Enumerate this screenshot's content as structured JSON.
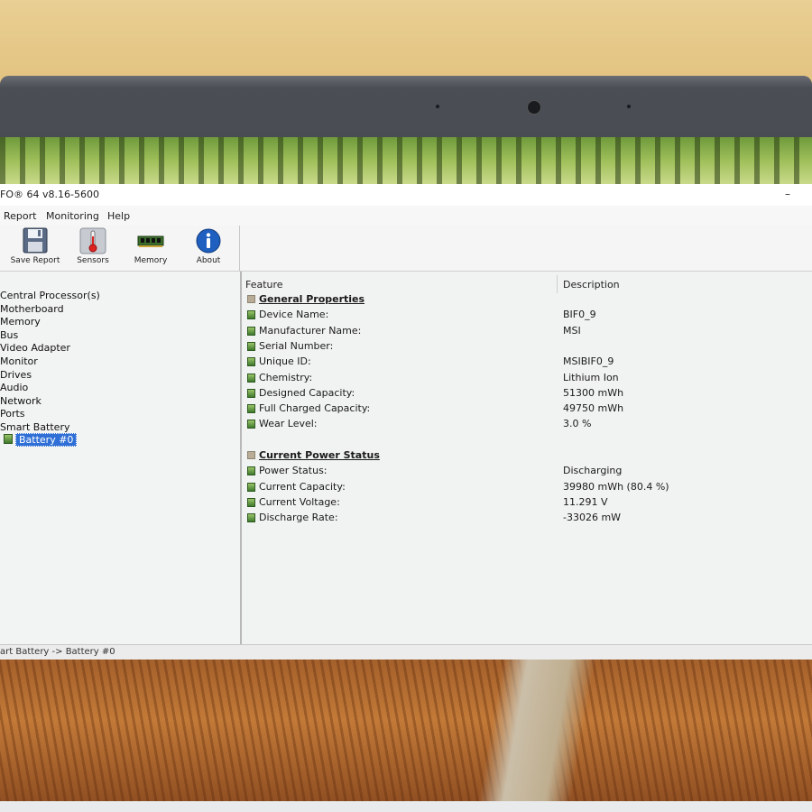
{
  "window": {
    "title": "FO® 64 v8.16-5600",
    "minimize_glyph": "–"
  },
  "menu": [
    "Report",
    "Monitoring",
    "Help"
  ],
  "toolbar": [
    {
      "label": "Save Report",
      "icon": "floppy-disk-icon"
    },
    {
      "label": "Sensors",
      "icon": "thermometer-icon"
    },
    {
      "label": "Memory",
      "icon": "memory-module-icon"
    },
    {
      "label": "About",
      "icon": "info-icon"
    }
  ],
  "tree": {
    "items": [
      "Central Processor(s)",
      "Motherboard",
      "Memory",
      "Bus",
      "Video Adapter",
      "Monitor",
      "Drives",
      "Audio",
      "Network",
      "Ports",
      "Smart Battery"
    ],
    "selected": "Battery #0"
  },
  "table": {
    "headers": {
      "feature": "Feature",
      "description": "Description"
    },
    "sections": [
      {
        "title": "General Properties",
        "rows": [
          {
            "feature": "Device Name:",
            "value": "BIF0_9"
          },
          {
            "feature": "Manufacturer Name:",
            "value": "MSI"
          },
          {
            "feature": "Serial Number:",
            "value": ""
          },
          {
            "feature": "Unique ID:",
            "value": "MSIBIF0_9"
          },
          {
            "feature": "Chemistry:",
            "value": "Lithium Ion"
          },
          {
            "feature": "Designed Capacity:",
            "value": "51300 mWh"
          },
          {
            "feature": "Full Charged Capacity:",
            "value": "49750 mWh"
          },
          {
            "feature": "Wear Level:",
            "value": "3.0 %"
          }
        ]
      },
      {
        "title": "Current Power Status",
        "rows": [
          {
            "feature": "Power Status:",
            "value": "Discharging"
          },
          {
            "feature": "Current Capacity:",
            "value": "39980 mWh (80.4 %)"
          },
          {
            "feature": "Current Voltage:",
            "value": "11.291 V"
          },
          {
            "feature": "Discharge Rate:",
            "value": "-33026 mW"
          }
        ]
      }
    ]
  },
  "status": {
    "text": "art Battery -> Battery #0"
  },
  "colors": {
    "selection": "#2f6fd6",
    "wall": "#e7c986",
    "bezel": "#3a3c42"
  }
}
